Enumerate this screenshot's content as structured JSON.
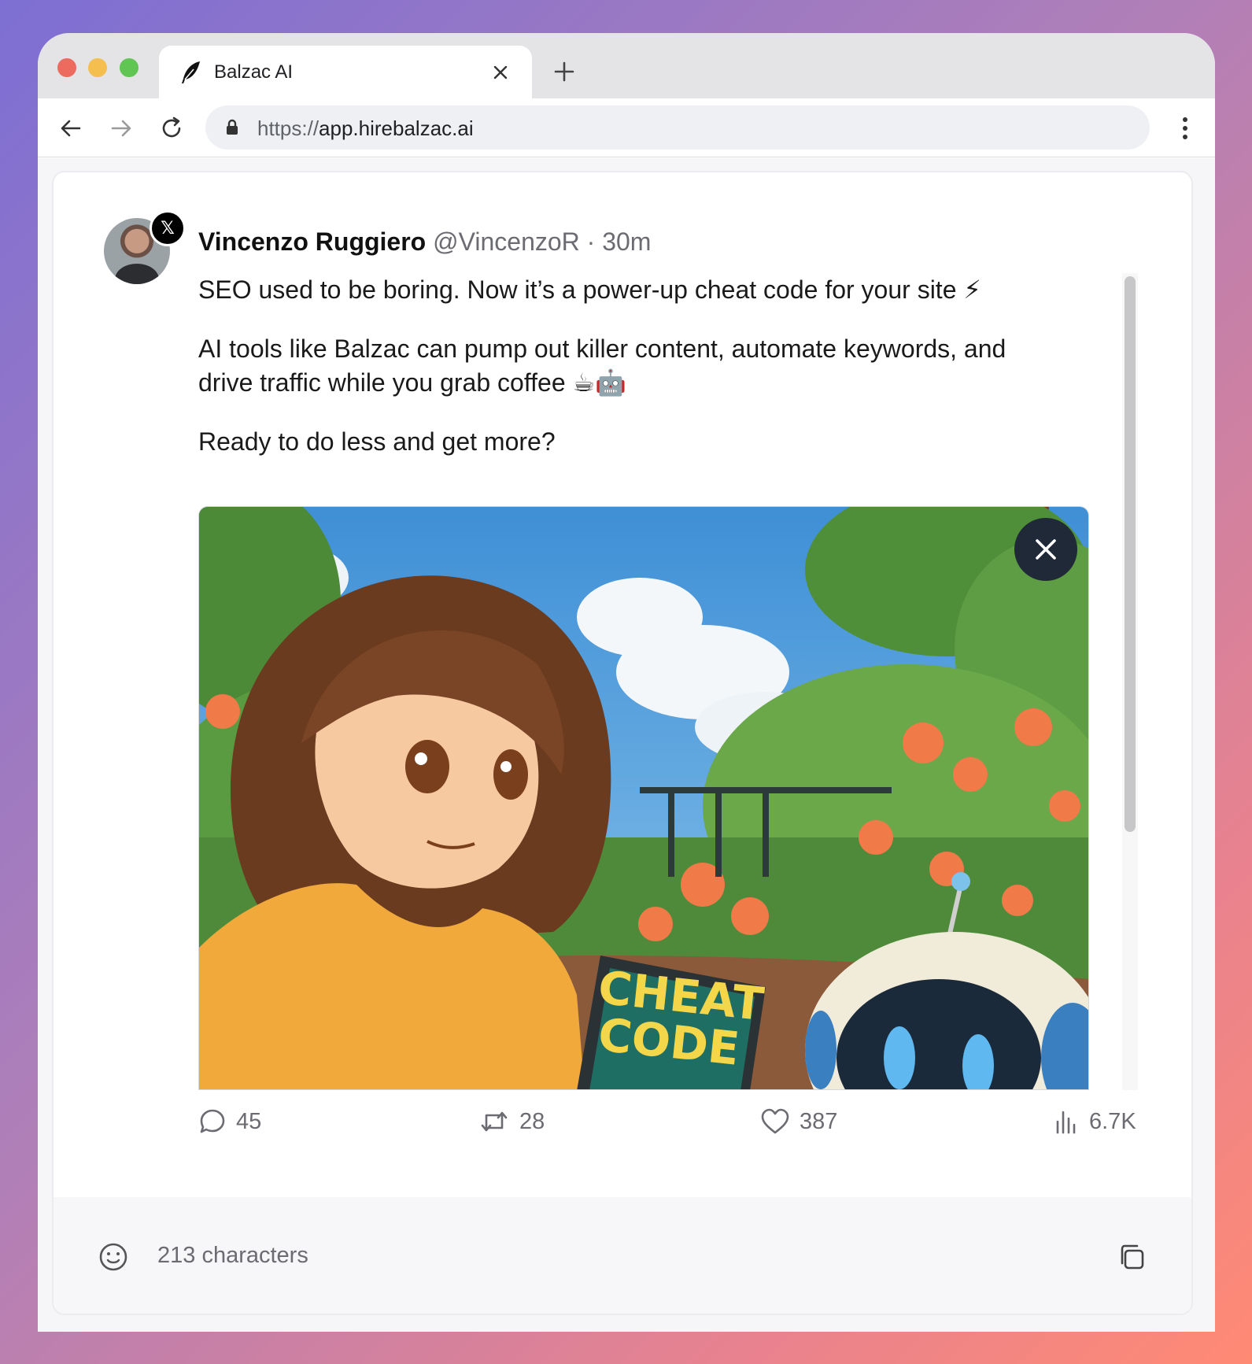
{
  "browser": {
    "tab_title": "Balzac AI",
    "url_scheme": "https://",
    "url_host": "app.hirebalzac.ai"
  },
  "post": {
    "author_name": "Vincenzo Ruggiero",
    "author_handle": "@VincenzoR",
    "timestamp": "· 30m",
    "platform_badge": "𝕏",
    "paragraphs": [
      "SEO used to be boring. Now it’s a power-up cheat code for your site ⚡",
      "AI tools like Balzac can pump out killer content, automate keywords, and drive traffic while you grab coffee ☕🤖",
      "Ready to do less and get more?"
    ],
    "image_text": [
      "CHEAT",
      "CODE"
    ],
    "stats": {
      "replies": "45",
      "reposts": "28",
      "likes": "387",
      "views": "6.7K"
    }
  },
  "footer": {
    "character_count": "213 characters"
  },
  "icons": {
    "tab": "quill-feather-icon",
    "close_tab": "close-icon",
    "new_tab": "plus-icon",
    "back": "arrow-left-icon",
    "forward": "arrow-right-icon",
    "reload": "reload-icon",
    "lock": "lock-icon",
    "menu": "kebab-menu-icon",
    "reply": "chat-bubble-icon",
    "repost": "repost-icon",
    "like": "heart-icon",
    "views": "bar-chart-icon",
    "emoji": "smiley-icon",
    "copy": "copy-icon",
    "remove_media": "close-icon"
  },
  "colors": {
    "accent_bolt": "#f5b82e",
    "text_primary": "#1a1a1a",
    "text_muted": "#6b6b72"
  }
}
